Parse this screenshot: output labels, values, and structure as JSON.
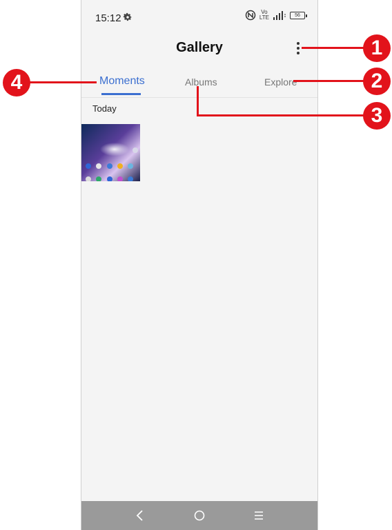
{
  "status_bar": {
    "time": "15:12",
    "volte_top": "Vo",
    "volte_bottom": "LTE",
    "battery": "56"
  },
  "header": {
    "title": "Gallery"
  },
  "tabs": [
    {
      "label": "Moments",
      "active": true
    },
    {
      "label": "Albums",
      "active": false
    },
    {
      "label": "Explore",
      "active": false
    }
  ],
  "section": {
    "label": "Today"
  },
  "callouts": [
    "1",
    "2",
    "3",
    "4"
  ],
  "colors": {
    "accent": "#3b6fd0",
    "callout": "#e2131b",
    "background": "#f4f4f4",
    "navbar": "#9a9a9a"
  }
}
